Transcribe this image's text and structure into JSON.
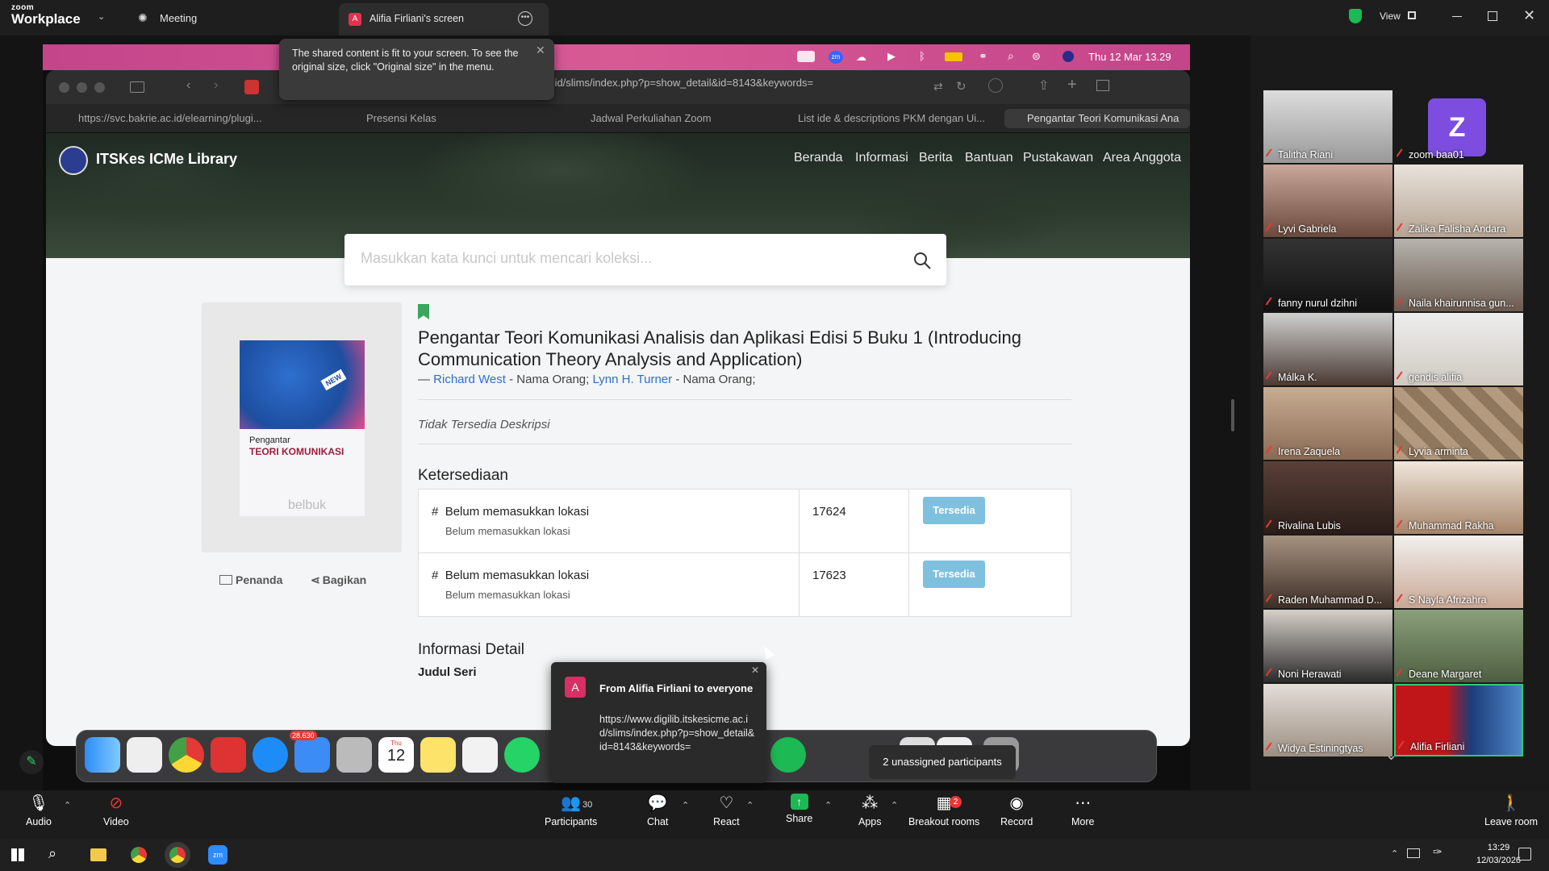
{
  "zoom": {
    "logo_small": "zoom",
    "logo_big": "Workplace",
    "meeting_label": "Meeting",
    "share_tab_label": "Alifia Firliani's screen",
    "share_tab_avatar": "A",
    "view_label": "View"
  },
  "tooltip": {
    "text": "The shared content is fit to your screen. To see the original size, click \"Original size\" in the menu."
  },
  "mac": {
    "menubar_time": "Thu 12 Mar  13.29"
  },
  "browser": {
    "url": "https://www.digilib.itskesicme.ac.id/slims/index.php?p=show_detail&id=8143&keywords=",
    "tabs": [
      "https://svc.bakrie.ac.id/elearning/plugi...",
      "Presensi Kelas",
      "Jadwal Perkuliahan Zoom",
      "List ide & descriptions PKM dengan Ui...",
      "Pengantar Teori Komunikasi Ana"
    ]
  },
  "site": {
    "title": "ITSKes ICMe Library",
    "nav": [
      "Beranda",
      "Informasi",
      "Berita",
      "Bantuan",
      "Pustakawan",
      "Area Anggota"
    ],
    "search_placeholder": "Masukkan kata kunci untuk mencari koleksi...",
    "book": {
      "title": "Pengantar Teori Komunikasi Analisis dan Aplikasi Edisi 5 Buku 1 (Introducing Communication Theory Analysis and Application)",
      "author_prefix": "— ",
      "author1": "Richard West",
      "author1_role": " - Nama Orang; ",
      "author2": "Lynn H. Turner",
      "author2_role": " - Nama Orang;",
      "description": "Tidak Tersedia Deskripsi",
      "cover_title1": "Pengantar",
      "cover_title2": "TEORI KOMUNIKASI",
      "cover_badge": "NEW",
      "cover_publisher": "belbuk"
    },
    "bookmark_label": "Penanda",
    "share_label": "Bagikan",
    "availability_heading": "Ketersediaan",
    "availability": [
      {
        "hash": "#",
        "location": "Belum memasukkan lokasi",
        "sublocation": "Belum memasukkan lokasi",
        "code": "17624",
        "status": "Tersedia"
      },
      {
        "hash": "#",
        "location": "Belum memasukkan lokasi",
        "sublocation": "Belum memasukkan lokasi",
        "code": "17623",
        "status": "Tersedia"
      }
    ],
    "detail_heading": "Informasi Detail",
    "series_label": "Judul Seri"
  },
  "chat_popup": {
    "avatar": "A",
    "title": "From Alifia Firliani to everyone",
    "message": "https://www.digilib.itskesicme.ac.id/slims/index.php?p=show_detail&id=8143&keywords="
  },
  "dock": {
    "mail_badge": "28.630",
    "calendar_month": "Thu",
    "calendar_day": "12",
    "unassigned": "2 unassigned participants"
  },
  "participants": [
    "Talitha Riani",
    "zoom baa01",
    "Lyvi Gabriela",
    "Zalika Falisha Andara",
    "fanny nurul dzihni",
    "Naila khairunnisa gun...",
    "Málka K.",
    "gendis alifia",
    "Irena Zaquela",
    "Lyvia arminta",
    "Rivalina Lubis",
    "Muhammad Rakha",
    "Raden Muhammad D...",
    "S Nayla Afrizahra",
    "Noni Herawati",
    "Deane Margaret",
    "Widya Estiningtyas",
    "Alifia Firliani"
  ],
  "zoom_avatar_letter": "Z",
  "controls": {
    "audio": "Audio",
    "video": "Video",
    "participants": "Participants",
    "participants_count": "30",
    "chat": "Chat",
    "react": "React",
    "share": "Share",
    "apps": "Apps",
    "breakout": "Breakout rooms",
    "breakout_badge": "2",
    "record": "Record",
    "more": "More",
    "leave": "Leave room"
  },
  "taskbar": {
    "time": "13:29",
    "date": "12/03/2026"
  }
}
